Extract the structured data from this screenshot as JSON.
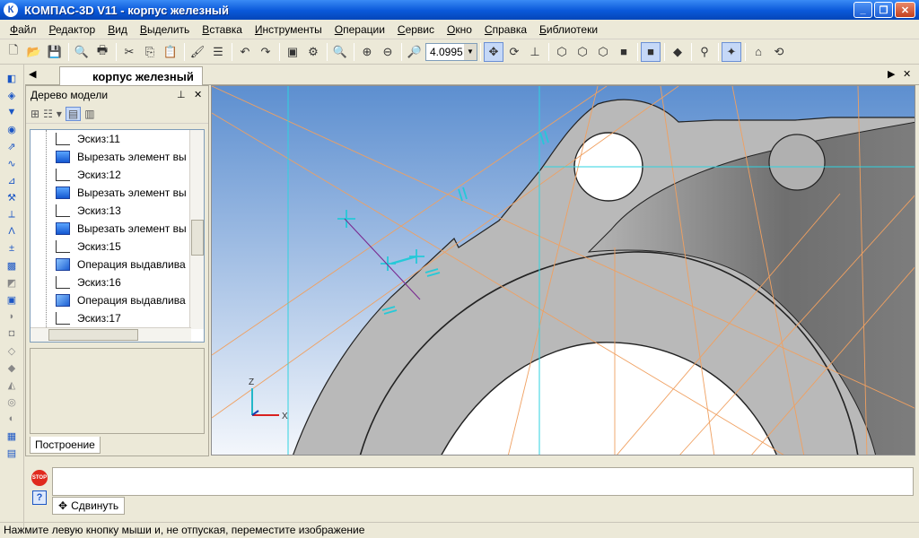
{
  "window": {
    "title": "КОМПАС-3D V11 - корпус железный",
    "app_icon": "К"
  },
  "window_controls": {
    "minimize": "_",
    "maximize": "❐",
    "close": "✕"
  },
  "menu": [
    "Файл",
    "Редактор",
    "Вид",
    "Выделить",
    "Вставка",
    "Инструменты",
    "Операции",
    "Сервис",
    "Окно",
    "Справка",
    "Библиотеки"
  ],
  "toolbar": {
    "zoom_value": "4.0995"
  },
  "document_tab": {
    "label": "корпус железный"
  },
  "tree_panel": {
    "title": "Дерево модели",
    "items": [
      {
        "label": "Эскиз:11",
        "type": "sketch"
      },
      {
        "label": "Вырезать элемент вы",
        "type": "cut"
      },
      {
        "label": "Эскиз:12",
        "type": "sketch"
      },
      {
        "label": "Вырезать элемент вы",
        "type": "cut"
      },
      {
        "label": "Эскиз:13",
        "type": "sketch"
      },
      {
        "label": "Вырезать элемент вы",
        "type": "cut"
      },
      {
        "label": "Эскиз:15",
        "type": "sketch"
      },
      {
        "label": "Операция выдавлива",
        "type": "extrude"
      },
      {
        "label": "Эскиз:16",
        "type": "sketch"
      },
      {
        "label": "Операция выдавлива",
        "type": "extrude"
      },
      {
        "label": "Эскиз:17",
        "type": "sketch"
      }
    ],
    "tab_label": "Построение"
  },
  "viewport": {
    "axis_z": "Z",
    "axis_x": "X",
    "colors": {
      "background_top": "#5d8fd0",
      "background_bottom": "#f4f7fc",
      "part": "#b9b9b9",
      "part_dark": "#777777",
      "construction": "#f0a060",
      "axis_line": "#2ed3e0"
    }
  },
  "command_panel": {
    "stop_label": "STOP",
    "help_label": "?",
    "tab_label": "Сдвинуть"
  },
  "status": "Нажмите левую кнопку мыши и, не отпуская, переместите изображение"
}
